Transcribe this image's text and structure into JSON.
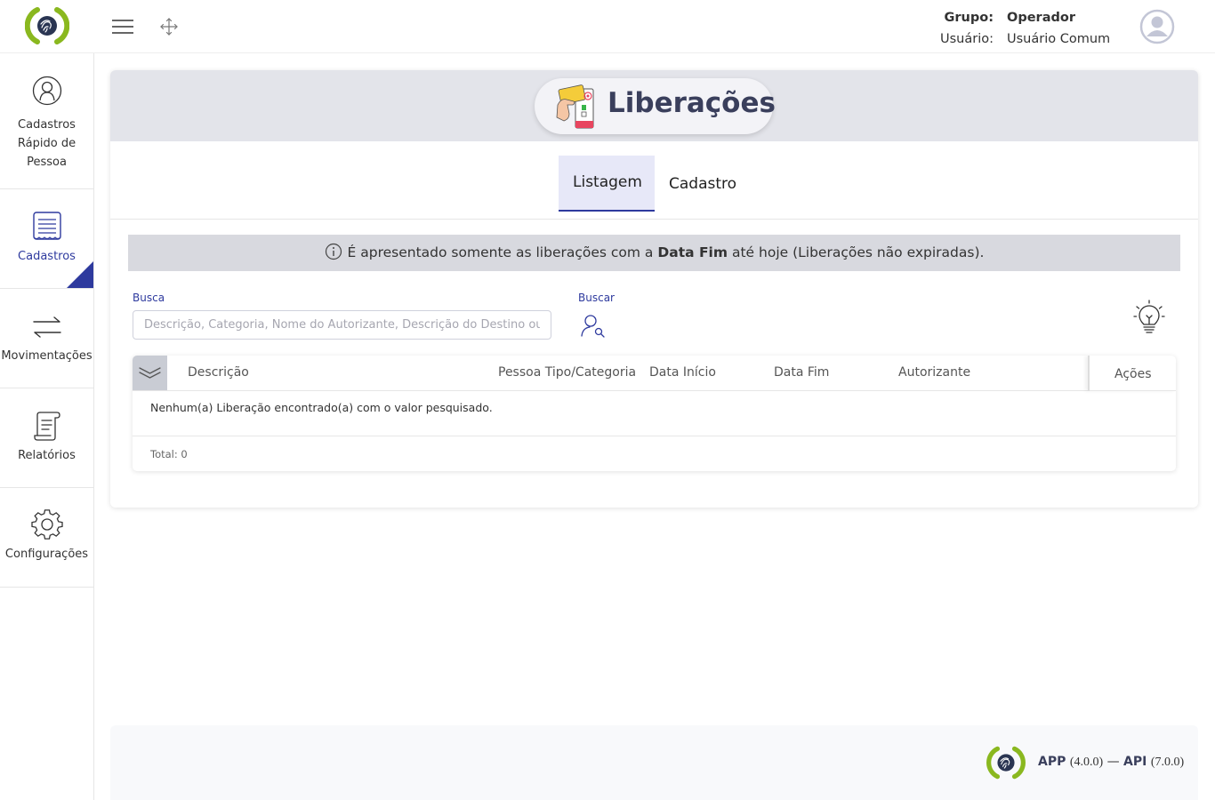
{
  "header": {
    "group_label": "Grupo:",
    "group_value": "Operador",
    "user_label": "Usuário:",
    "user_value": "Usuário Comum"
  },
  "sidebar": {
    "items": [
      {
        "label": "Cadastros Rápido de Pessoa",
        "icon": "user-circle-icon"
      },
      {
        "label": "Cadastros",
        "icon": "form-list-icon",
        "active": true
      },
      {
        "label": "Movimentações",
        "icon": "swap-arrows-icon"
      },
      {
        "label": "Relatórios",
        "icon": "report-scroll-icon"
      },
      {
        "label": "Configurações",
        "icon": "gear-icon"
      }
    ]
  },
  "page": {
    "title": "Liberações",
    "tabs": [
      {
        "label": "Listagem",
        "active": true
      },
      {
        "label": "Cadastro",
        "active": false
      }
    ],
    "info": {
      "prefix": "É apresentado somente as liberações com a",
      "bold": "Data Fim",
      "suffix": "até hoje (Liberações não expiradas)."
    },
    "search": {
      "label": "Busca",
      "placeholder": "Descrição, Categoria, Nome do Autorizante, Descrição do Destino ou Código",
      "value": "",
      "button_label": "Buscar"
    },
    "table": {
      "columns": [
        "Descrição",
        "Pessoa Tipo/Categoria",
        "Data Início",
        "Data Fim",
        "Autorizante"
      ],
      "actions_label": "Ações",
      "empty_message": "Nenhum(a) Liberação encontrado(a) com o valor pesquisado.",
      "total_label": "Total: 0"
    }
  },
  "footer": {
    "app_label": "APP",
    "app_version": "(4.0.0)",
    "separator": "—",
    "api_label": "API",
    "api_version": "(7.0.0)"
  },
  "colors": {
    "accent": "#2e3a9e",
    "logo_green": "#8ab81f",
    "header_bg": "#e3e4ea"
  }
}
